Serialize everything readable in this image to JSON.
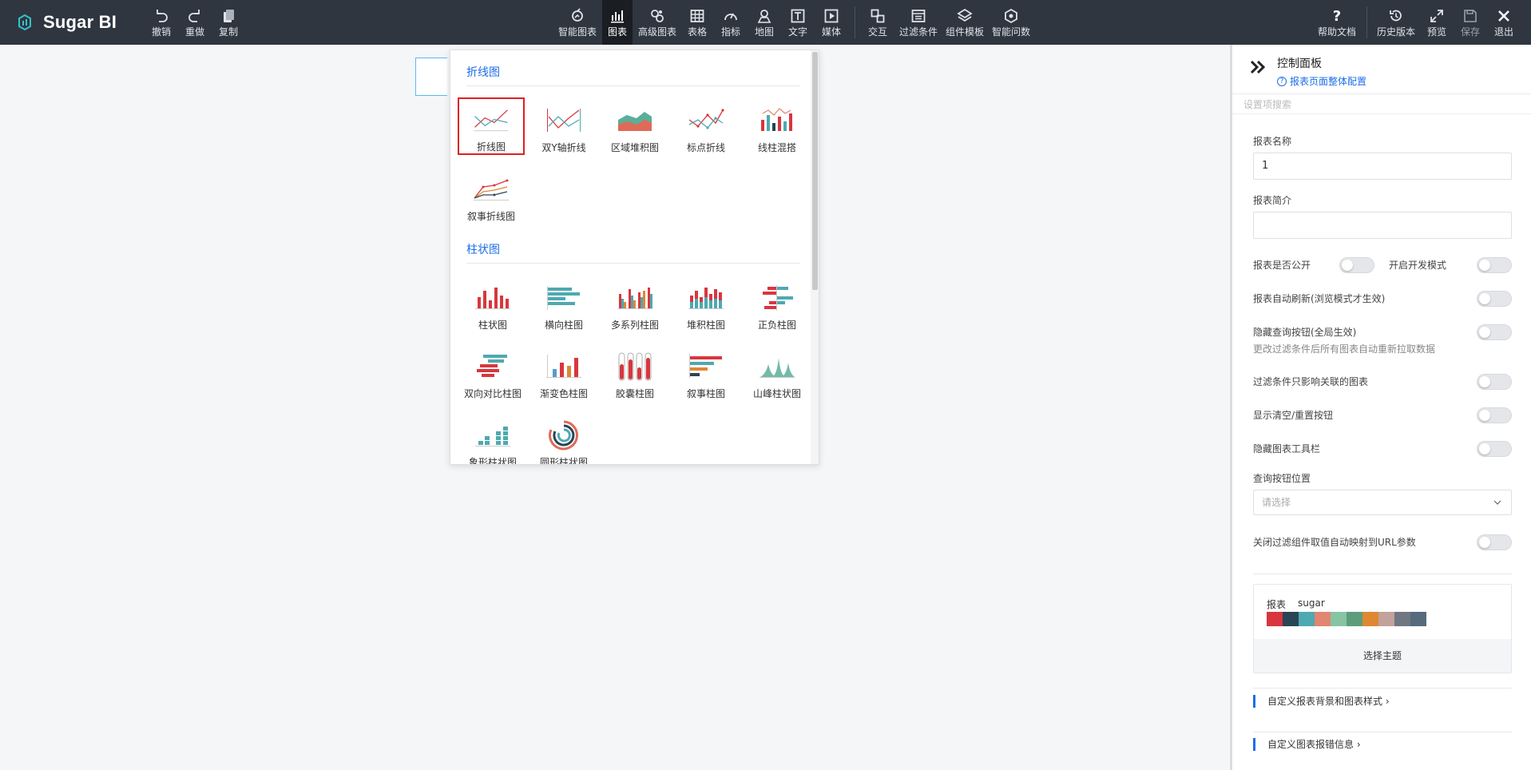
{
  "app": {
    "name": "Sugar BI"
  },
  "colors": {
    "topbar": "#2f3640",
    "accent": "#1c6ee8",
    "selected_border": "#e02020"
  },
  "toolbar": {
    "left": [
      {
        "id": "undo",
        "label": "撤销",
        "icon": "undo-icon"
      },
      {
        "id": "redo",
        "label": "重做",
        "icon": "redo-icon"
      },
      {
        "id": "copy",
        "label": "复制",
        "icon": "copy-icon"
      }
    ],
    "center": [
      {
        "id": "smart-chart",
        "label": "智能图表",
        "icon": "smart-chart-icon"
      },
      {
        "id": "chart",
        "label": "图表",
        "icon": "bar-chart-icon",
        "active": true
      },
      {
        "id": "advanced-chart",
        "label": "高级图表",
        "icon": "advanced-chart-icon"
      },
      {
        "id": "table",
        "label": "表格",
        "icon": "table-icon"
      },
      {
        "id": "metric",
        "label": "指标",
        "icon": "gauge-icon"
      },
      {
        "id": "map",
        "label": "地图",
        "icon": "map-pin-icon"
      },
      {
        "id": "text",
        "label": "文字",
        "icon": "text-icon"
      },
      {
        "id": "media",
        "label": "媒体",
        "icon": "media-icon"
      },
      {
        "id": "interaction",
        "label": "交互",
        "icon": "interaction-icon"
      },
      {
        "id": "filter",
        "label": "过滤条件",
        "icon": "filter-icon"
      },
      {
        "id": "component-template",
        "label": "组件模板",
        "icon": "template-icon"
      },
      {
        "id": "smart-qa",
        "label": "智能问数",
        "icon": "smart-qa-icon"
      }
    ],
    "right": [
      {
        "id": "help",
        "label": "帮助文档",
        "icon": "help-icon"
      },
      {
        "id": "history",
        "label": "历史版本",
        "icon": "history-icon"
      },
      {
        "id": "preview",
        "label": "预览",
        "icon": "expand-icon"
      },
      {
        "id": "save",
        "label": "保存",
        "icon": "save-icon"
      },
      {
        "id": "exit",
        "label": "退出",
        "icon": "close-icon"
      }
    ]
  },
  "picker": {
    "sections": [
      {
        "title": "折线图",
        "items": [
          {
            "label": "折线图",
            "icon": "line-chart-icon",
            "selected": true
          },
          {
            "label": "双Y轴折线",
            "icon": "dual-axis-line-icon"
          },
          {
            "label": "区域堆积图",
            "icon": "stacked-area-icon"
          },
          {
            "label": "标点折线",
            "icon": "point-line-icon"
          },
          {
            "label": "线柱混搭",
            "icon": "line-bar-combo-icon"
          },
          {
            "label": "叙事折线图",
            "icon": "narrative-line-icon"
          }
        ]
      },
      {
        "title": "柱状图",
        "items": [
          {
            "label": "柱状图",
            "icon": "bar-chart-icon"
          },
          {
            "label": "横向柱图",
            "icon": "horizontal-bar-icon"
          },
          {
            "label": "多系列柱图",
            "icon": "multi-series-bar-icon"
          },
          {
            "label": "堆积柱图",
            "icon": "stacked-bar-icon"
          },
          {
            "label": "正负柱图",
            "icon": "pos-neg-bar-icon"
          },
          {
            "label": "双向对比柱图",
            "icon": "bidirectional-bar-icon"
          },
          {
            "label": "渐变色柱图",
            "icon": "gradient-bar-icon"
          },
          {
            "label": "胶囊柱图",
            "icon": "capsule-bar-icon"
          },
          {
            "label": "叙事柱图",
            "icon": "narrative-bar-icon"
          },
          {
            "label": "山峰柱状图",
            "icon": "mountain-bar-icon"
          },
          {
            "label": "象形柱状图",
            "icon": "pictorial-bar-icon"
          },
          {
            "label": "圆形柱状图",
            "icon": "circular-bar-icon"
          }
        ]
      }
    ]
  },
  "panel": {
    "title": "控制面板",
    "subtitle": "报表页面整体配置",
    "search_placeholder": "设置项搜索",
    "report_name_label": "报表名称",
    "report_name_value": "1",
    "report_intro_label": "报表简介",
    "report_intro_value": "",
    "public_label": "报表是否公开",
    "dev_mode_label": "开启开发模式",
    "auto_refresh_label": "报表自动刷新(浏览模式才生效)",
    "hide_query_label": "隐藏查询按钮(全局生效)",
    "hide_query_hint": "更改过滤条件后所有图表自动重新拉取数据",
    "filter_related_label": "过滤条件只影响关联的图表",
    "show_clear_label": "显示清空/重置按钮",
    "hide_toolbar_label": "隐藏图表工具栏",
    "query_pos_label": "查询按钮位置",
    "query_pos_placeholder": "请选择",
    "url_param_label": "关闭过滤组件取值自动映射到URL参数",
    "theme_name_label": "报表",
    "theme_value": "sugar",
    "theme_colors": [
      "#d9363e",
      "#2a4556",
      "#4ea9b0",
      "#e28571",
      "#86c4a3",
      "#5d9d7e",
      "#df8733",
      "#c3a19c",
      "#6f7782",
      "#566b7c"
    ],
    "theme_button": "选择主题",
    "custom_bg_link": "自定义报表背景和图表样式",
    "custom_error_link": "自定义图表报错信息"
  }
}
